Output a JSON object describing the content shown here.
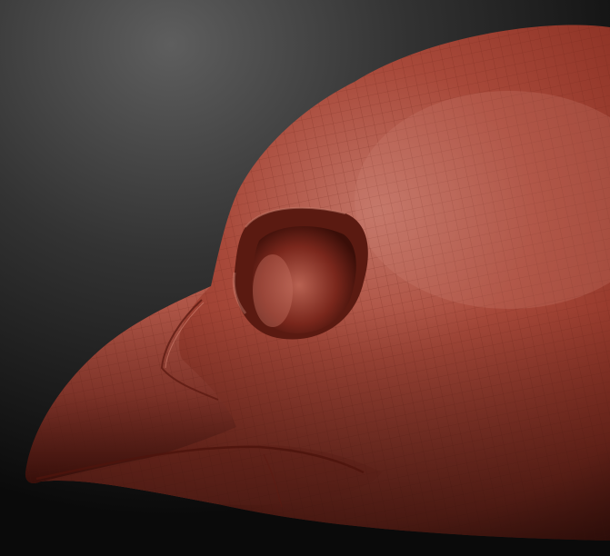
{
  "scene": {
    "subject": "bird-head-sculpt",
    "render_style": "wireframe-shaded",
    "colors": {
      "background_top": "#5e5e5e",
      "background_bottom": "#0a0a0a",
      "material_light": "#c27466",
      "material_mid": "#9c3f32",
      "material_dark": "#4a130c",
      "wire": "#6b2218"
    }
  }
}
